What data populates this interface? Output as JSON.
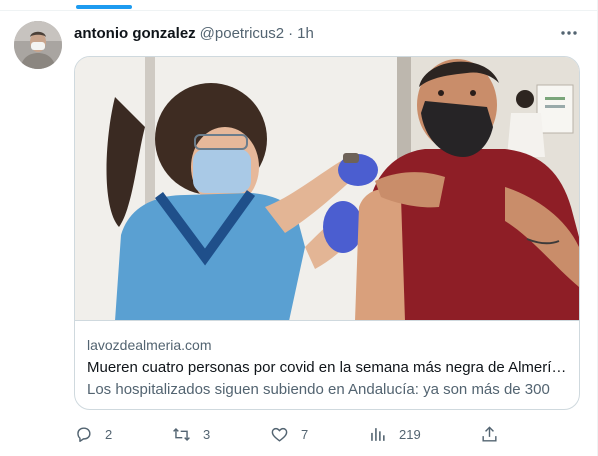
{
  "tweet": {
    "author_name": "antonio gonzalez",
    "author_handle": "@poetricus2",
    "separator": "·",
    "timestamp": "1h"
  },
  "card": {
    "domain": "lavozdealmeria.com",
    "title": "Mueren cuatro personas por covid en la semana más negra de Almería...",
    "description": "Los hospitalizados siguen subiendo en Andalucía: ya son más de 300"
  },
  "actions": {
    "replies": "2",
    "retweets": "3",
    "likes": "7",
    "views": "219"
  },
  "icons": {
    "more": "more-horizontal-icon",
    "reply": "reply-icon",
    "retweet": "retweet-icon",
    "like": "heart-icon",
    "views": "views-chart-icon",
    "share": "share-icon"
  },
  "colors": {
    "accent": "#1d9bf0",
    "secondary_text": "#536471",
    "border": "#cfd9de"
  }
}
